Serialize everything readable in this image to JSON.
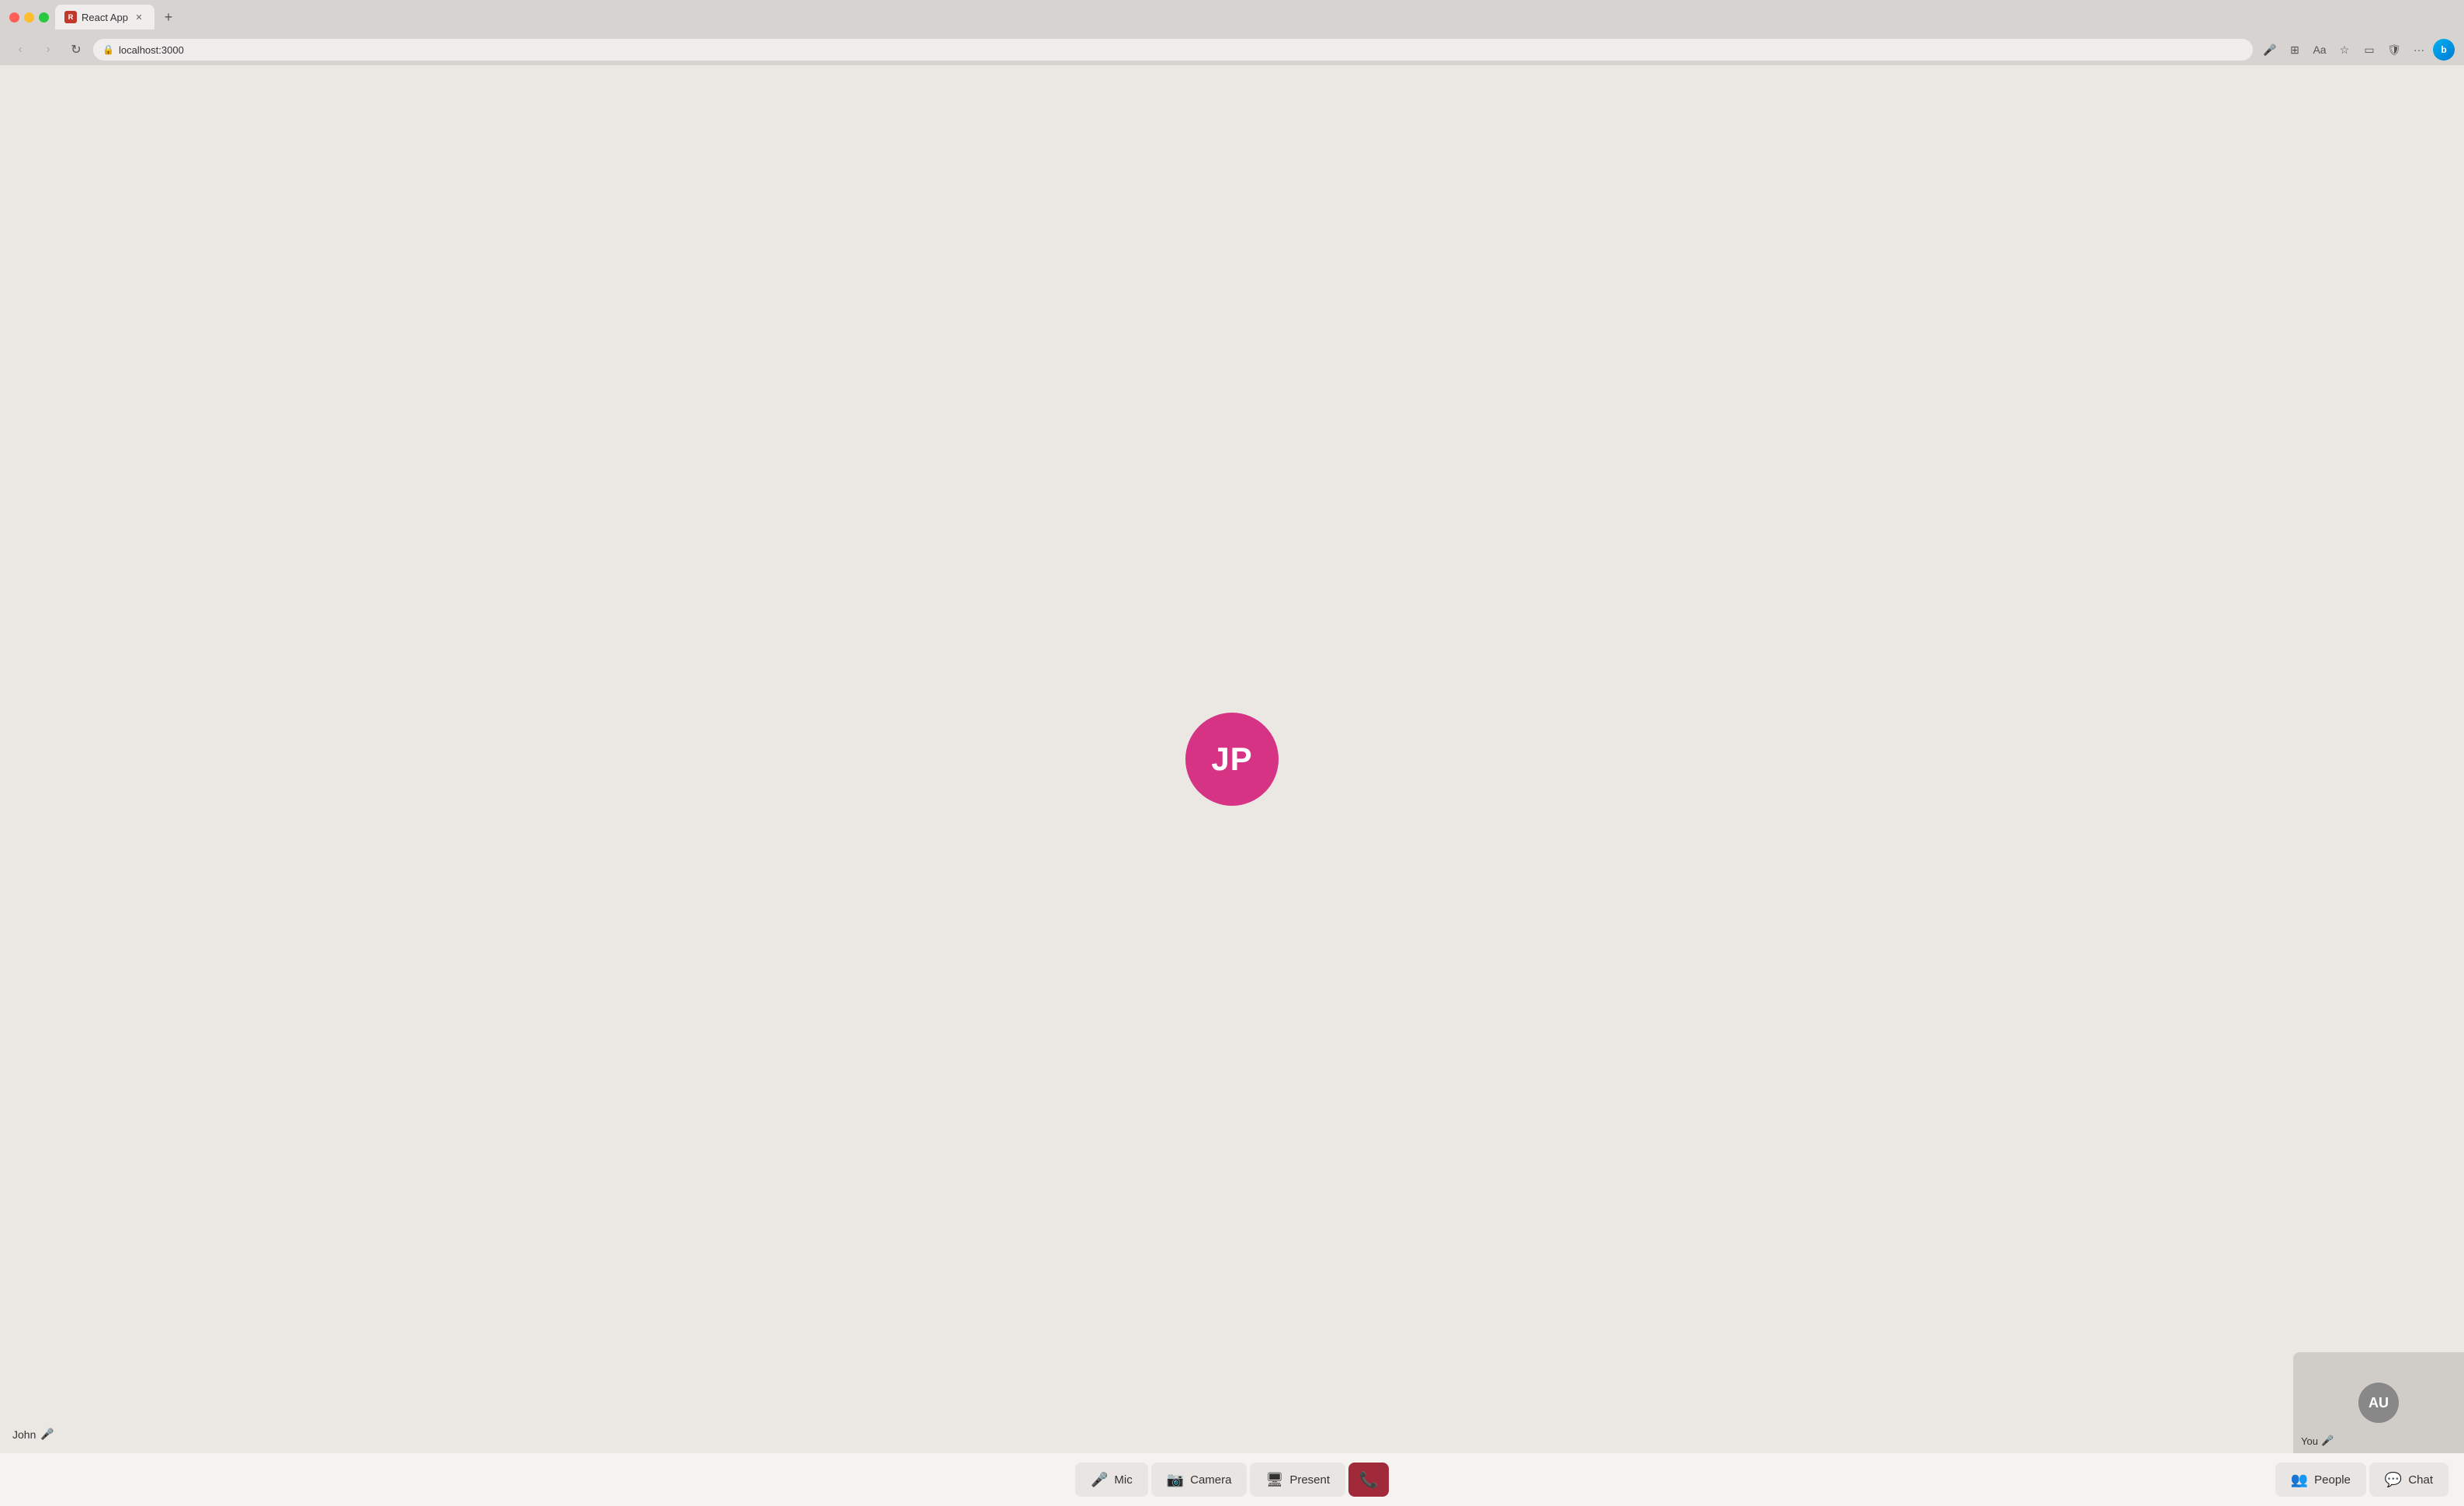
{
  "browser": {
    "tab_title": "React App",
    "tab_favicon": "R",
    "address": "localhost:3000",
    "new_tab_symbol": "+",
    "nav_back": "‹",
    "nav_forward": "›",
    "nav_refresh": "↻"
  },
  "call": {
    "main_participant_initials": "JP",
    "main_participant_bg": "#d63384",
    "main_participant_name": "John",
    "self_initials": "AU",
    "self_label": "You",
    "self_bg": "#888888"
  },
  "controls": {
    "mic_label": "Mic",
    "camera_label": "Camera",
    "present_label": "Present",
    "people_label": "People",
    "chat_label": "Chat"
  }
}
